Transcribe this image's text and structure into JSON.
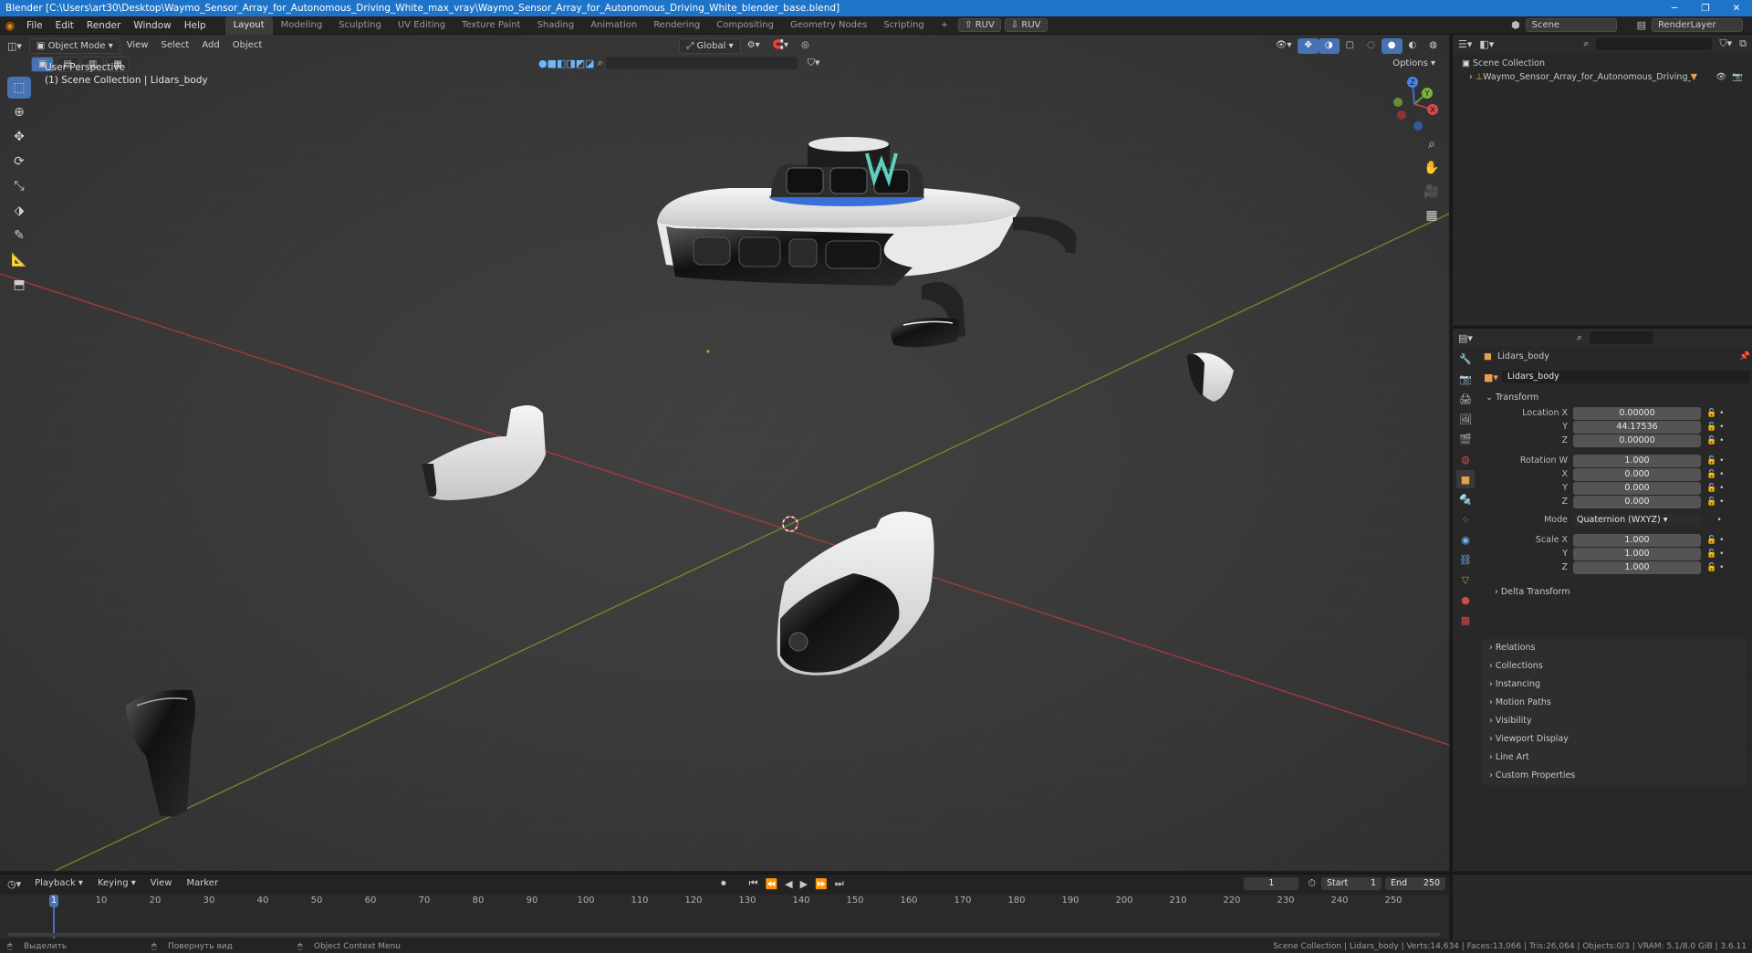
{
  "window": {
    "title": "Blender [C:\\Users\\art30\\Desktop\\Waymo_Sensor_Array_for_Autonomous_Driving_White_max_vray\\Waymo_Sensor_Array_for_Autonomous_Driving_White_blender_base.blend]"
  },
  "menu": [
    "File",
    "Edit",
    "Render",
    "Window",
    "Help"
  ],
  "workspaces": [
    "Layout",
    "Modeling",
    "Sculpting",
    "UV Editing",
    "Texture Paint",
    "Shading",
    "Animation",
    "Rendering",
    "Compositing",
    "Geometry Nodes",
    "Scripting"
  ],
  "active_workspace": "Layout",
  "topbar_right": {
    "ruv1": "RUV",
    "ruv2": "RUV",
    "scene": "Scene",
    "render_layer": "RenderLayer"
  },
  "viewport": {
    "mode": "Object Mode",
    "header_menu": [
      "View",
      "Select",
      "Add",
      "Object"
    ],
    "transform_orientation": "Global",
    "options_label": "Options",
    "overlay_line1": "User Perspective",
    "overlay_line2": "(1) Scene Collection | Lidars_body",
    "gizmo_axes": [
      "X",
      "Y",
      "Z"
    ]
  },
  "outliner": {
    "root": "Scene Collection",
    "items": [
      "Waymo_Sensor_Array_for_Autonomous_Driving_White"
    ]
  },
  "properties": {
    "object_name": "Lidars_body",
    "datablock_name": "Lidars_body",
    "section": "Transform",
    "location": {
      "label_x": "Location X",
      "label_y": "Y",
      "label_z": "Z",
      "x": "0.00000",
      "y": "44.17536",
      "z": "0.00000"
    },
    "rotation": {
      "label_w": "Rotation W",
      "label_x": "X",
      "label_y": "Y",
      "label_z": "Z",
      "w": "1.000",
      "x": "0.000",
      "y": "0.000",
      "z": "0.000"
    },
    "mode": {
      "label": "Mode",
      "value": "Quaternion (WXYZ)"
    },
    "scale": {
      "label_x": "Scale X",
      "label_y": "Y",
      "label_z": "Z",
      "x": "1.000",
      "y": "1.000",
      "z": "1.000"
    },
    "delta": "Delta Transform",
    "collapsed_panels": [
      "Relations",
      "Collections",
      "Instancing",
      "Motion Paths",
      "Visibility",
      "Viewport Display",
      "Line Art",
      "Custom Properties"
    ]
  },
  "timeline": {
    "menu": [
      "Playback",
      "Keying",
      "View",
      "Marker"
    ],
    "current_frame": "1",
    "start_label": "Start",
    "start": "1",
    "end_label": "End",
    "end": "250",
    "ticks": [
      "1",
      "10",
      "20",
      "30",
      "40",
      "50",
      "60",
      "70",
      "80",
      "90",
      "100",
      "110",
      "120",
      "130",
      "140",
      "150",
      "160",
      "170",
      "180",
      "190",
      "200",
      "210",
      "220",
      "230",
      "240",
      "250"
    ]
  },
  "statusbar": {
    "left1": "Выделить",
    "left2": "Повернуть вид",
    "left3": "Object Context Menu",
    "right": "Scene Collection | Lidars_body | Verts:14,634 | Faces:13,066 | Tris:26,064 | Objects:0/3 | VRAM: 5.1/8.0 GiB | 3.6.11"
  },
  "colors": {
    "accent": "#4772b3",
    "titlebar": "#1e74c8",
    "x_axis": "#b43c3c",
    "y_axis": "#6f9a2a",
    "z_axis": "#3e6fd1"
  }
}
